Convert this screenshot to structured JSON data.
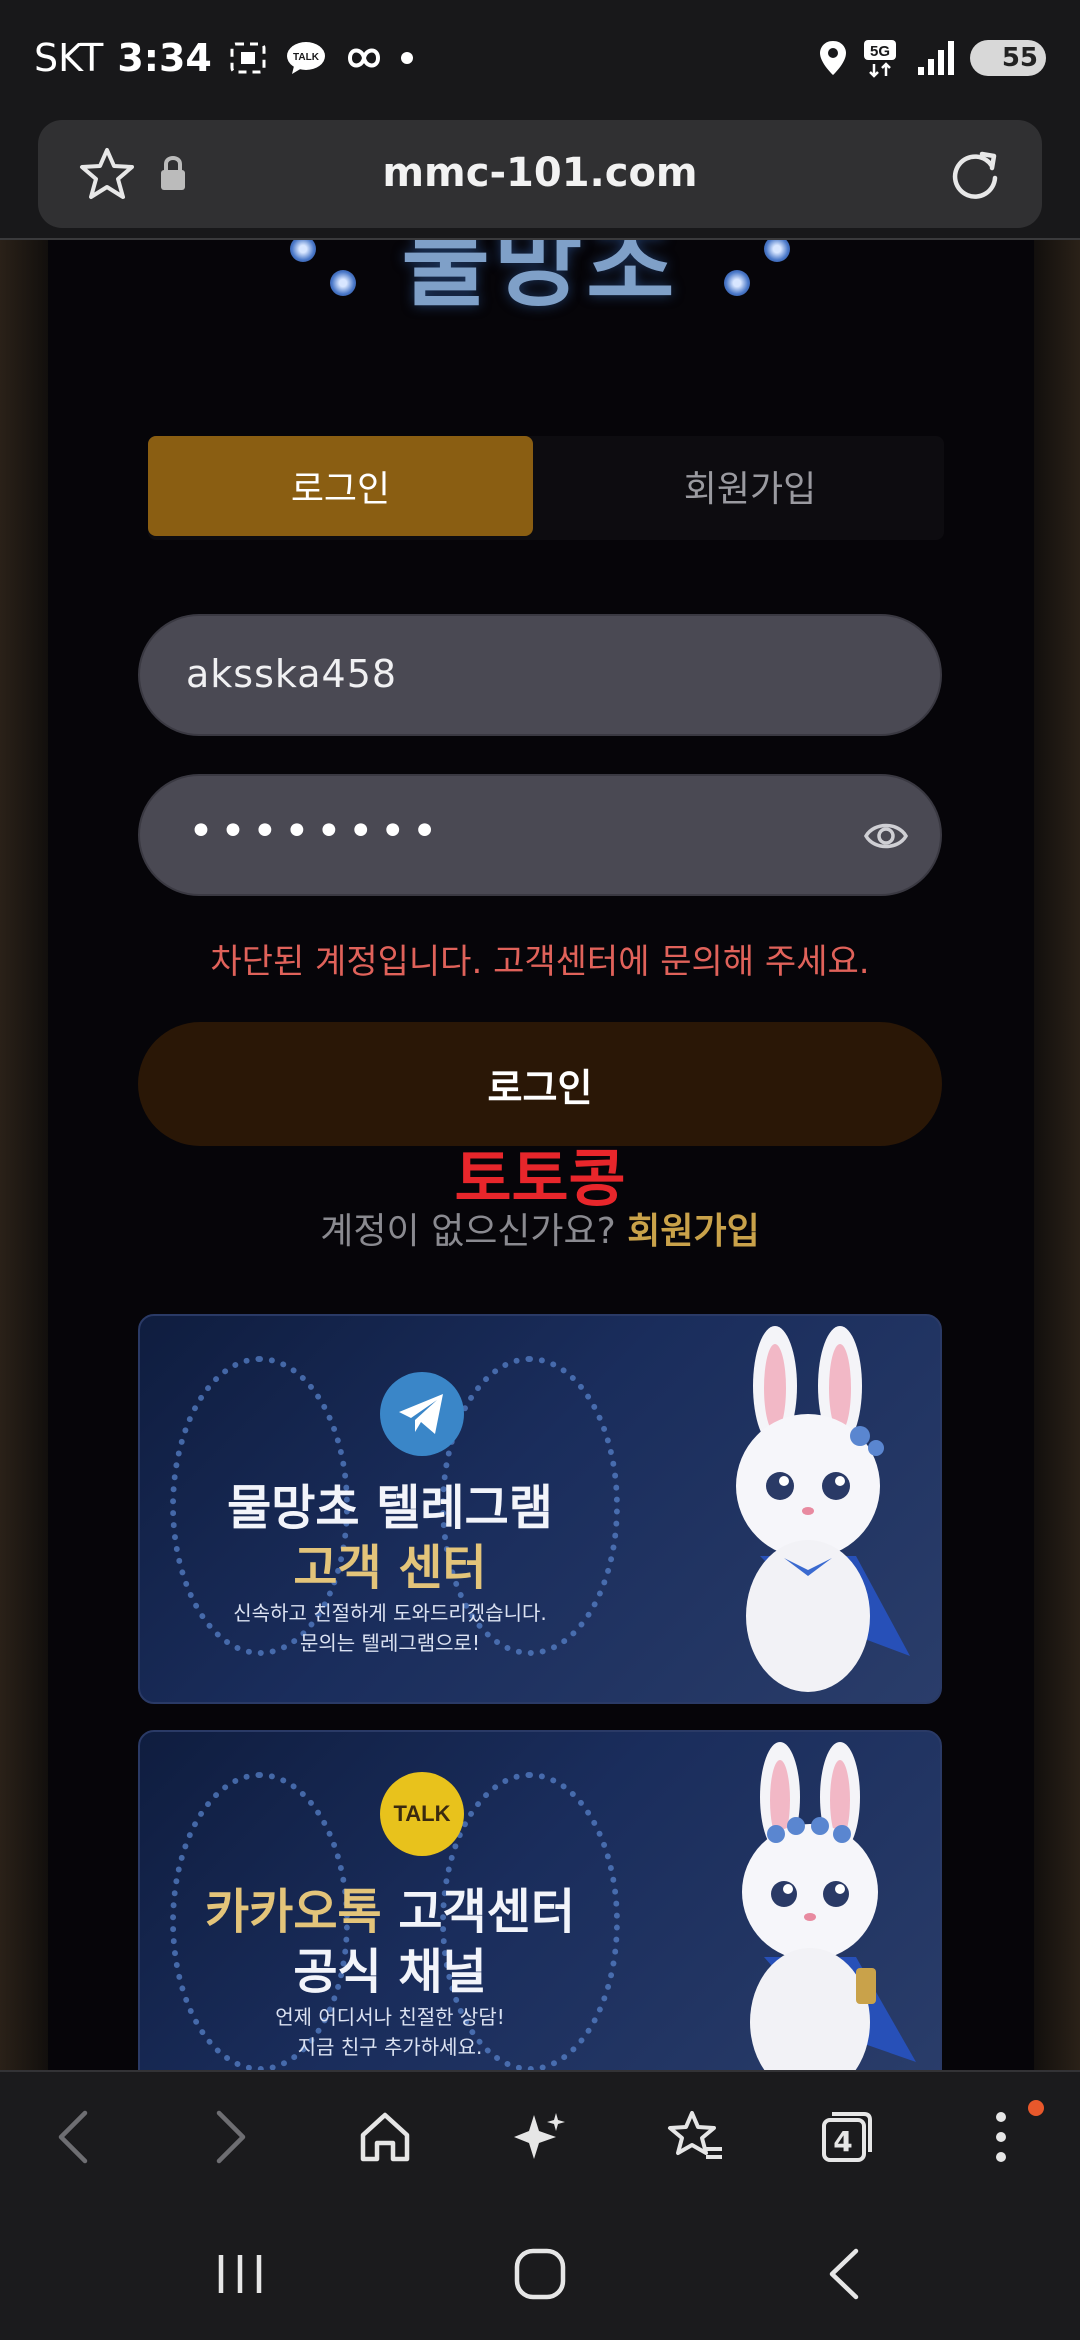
{
  "status_bar": {
    "carrier": "SKT",
    "time": "3:34",
    "battery": "55",
    "network": "5G",
    "icons": [
      "screenshot-icon",
      "talk-icon",
      "infinity-icon",
      "dot-icon",
      "location-icon",
      "5g-icon",
      "signal-icon",
      "battery-icon"
    ]
  },
  "browser": {
    "url": "mmc-101.com",
    "tab_count": "4"
  },
  "page": {
    "logo_text": "물망초",
    "tabs": {
      "login": "로그인",
      "signup": "회원가입"
    },
    "username_value": "aksska458",
    "password_dots": "••••••••",
    "error_message": "차단된 계정입니다. 고객센터에 문의해 주세요.",
    "login_button": "로그인",
    "overlay_text": "토토콩",
    "signup_prompt": "계정이 없으신가요?",
    "signup_link": "회원가입"
  },
  "banners": [
    {
      "title_line1": "물망초 텔레그램",
      "title_line2": "고객 센터",
      "sub_line1": "신속하고 친절하게 도와드리겠습니다.",
      "sub_line2": "문의는 텔레그램으로!"
    },
    {
      "badge": "TALK",
      "title_line1_accent": "카카오톡",
      "title_line1_rest": " 고객센터",
      "title_line2": "공식 채널",
      "sub_line1": "언제 어디서나 친절한 상담!",
      "sub_line2": "지금 친구 추가하세요."
    }
  ],
  "colors": {
    "tab_active": "#8a5e12",
    "error": "#e0625a",
    "overlay": "#e8262b",
    "link": "#c9a24a",
    "telegram": "#3a86c8",
    "kakao": "#e8c21c"
  }
}
